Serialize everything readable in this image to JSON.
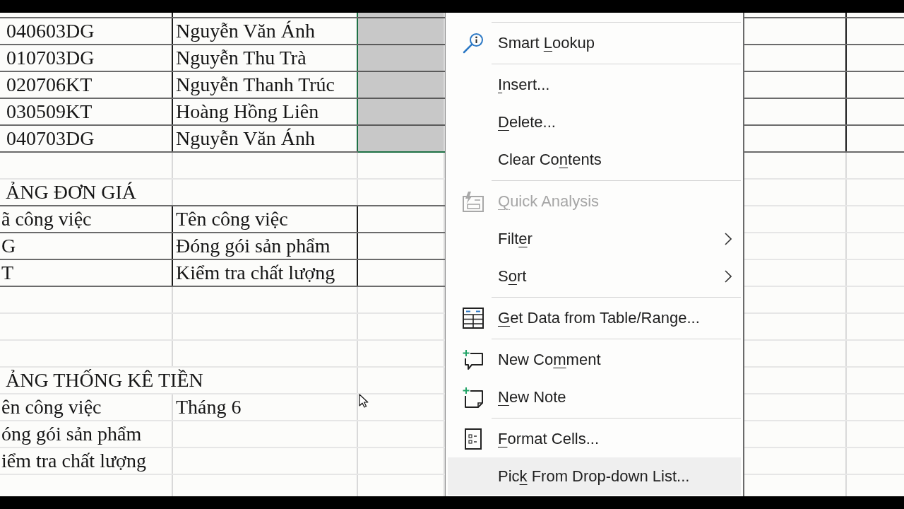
{
  "sheet": {
    "employees": [
      {
        "code": "040603DG",
        "name": "Nguyễn Văn Ánh",
        "selected": true
      },
      {
        "code": "010703DG",
        "name": "Nguyễn Thu Trà",
        "selected": true
      },
      {
        "code": "020706KT",
        "name": "Nguyễn Thanh Trúc",
        "selected": true
      },
      {
        "code": "030509KT",
        "name": "Hoàng Hồng Liên",
        "selected": true
      },
      {
        "code": "040703DG",
        "name": "Nguyễn Văn Ánh",
        "selected": true
      }
    ],
    "price_table": {
      "title": "ẢNG ĐƠN GIÁ",
      "columns": [
        "ã công việc",
        "Tên công việc"
      ],
      "rows": [
        [
          "G",
          "Đóng gói sản phẩm"
        ],
        [
          "T",
          "Kiểm tra chất lượng"
        ]
      ]
    },
    "summary_table": {
      "title": "ẢNG THỐNG KÊ TIỀN",
      "columns": [
        "ên công việc",
        "Tháng 6"
      ],
      "rows": [
        [
          "óng gói sản phẩm"
        ],
        [
          "iểm tra chất lượng"
        ]
      ]
    }
  },
  "context_menu": {
    "sections": [
      {
        "items": [
          {
            "label_parts": [
              {
                "text": "Smart ",
                "underlined": false
              },
              {
                "text": "L",
                "underlined": true
              },
              {
                "text": "ookup",
                "underlined": false
              }
            ],
            "disabled": false,
            "submenu": false,
            "highlighted": false
          }
        ]
      },
      {
        "items": [
          {
            "label_parts": [
              {
                "text": "I",
                "underlined": true
              },
              {
                "text": "nsert...",
                "underlined": false
              }
            ],
            "disabled": false,
            "submenu": false,
            "highlighted": false
          },
          {
            "label_parts": [
              {
                "text": "D",
                "underlined": true
              },
              {
                "text": "elete...",
                "underlined": false
              }
            ],
            "disabled": false,
            "submenu": false,
            "highlighted": false
          },
          {
            "label_parts": [
              {
                "text": "Clear Co",
                "underlined": false
              },
              {
                "text": "n",
                "underlined": true
              },
              {
                "text": "tents",
                "underlined": false
              }
            ],
            "disabled": false,
            "submenu": false,
            "highlighted": false
          }
        ]
      },
      {
        "items": [
          {
            "label_parts": [
              {
                "text": "Q",
                "underlined": true
              },
              {
                "text": "uick Analysis",
                "underlined": false
              }
            ],
            "disabled": true,
            "submenu": false,
            "highlighted": false
          },
          {
            "label_parts": [
              {
                "text": "Filt",
                "underlined": false
              },
              {
                "text": "e",
                "underlined": true
              },
              {
                "text": "r",
                "underlined": false
              }
            ],
            "disabled": false,
            "submenu": true,
            "highlighted": false
          },
          {
            "label_parts": [
              {
                "text": "S",
                "underlined": false
              },
              {
                "text": "o",
                "underlined": true
              },
              {
                "text": "rt",
                "underlined": false
              }
            ],
            "disabled": false,
            "submenu": true,
            "highlighted": false
          }
        ]
      },
      {
        "items": [
          {
            "label_parts": [
              {
                "text": "G",
                "underlined": true
              },
              {
                "text": "et Data from Table/Range...",
                "underlined": false
              }
            ],
            "disabled": false,
            "submenu": false,
            "highlighted": false
          }
        ]
      },
      {
        "items": [
          {
            "label_parts": [
              {
                "text": "New Co",
                "underlined": false
              },
              {
                "text": "m",
                "underlined": true
              },
              {
                "text": "ment",
                "underlined": false
              }
            ],
            "disabled": false,
            "submenu": false,
            "highlighted": false
          },
          {
            "label_parts": [
              {
                "text": "N",
                "underlined": true
              },
              {
                "text": "ew Note",
                "underlined": false
              }
            ],
            "disabled": false,
            "submenu": false,
            "highlighted": false
          }
        ]
      },
      {
        "items": [
          {
            "label_parts": [
              {
                "text": "F",
                "underlined": true
              },
              {
                "text": "ormat Cells...",
                "underlined": false
              }
            ],
            "disabled": false,
            "submenu": false,
            "highlighted": false
          },
          {
            "label_parts": [
              {
                "text": "Pic",
                "underlined": false
              },
              {
                "text": "k",
                "underlined": true
              },
              {
                "text": " From Drop-down List...",
                "underlined": false
              }
            ],
            "disabled": false,
            "submenu": false,
            "highlighted": true
          }
        ]
      }
    ]
  }
}
